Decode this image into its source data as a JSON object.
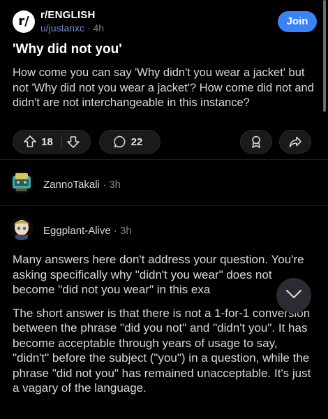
{
  "post": {
    "subreddit": "r/ENGLISH",
    "subreddit_icon": "r/",
    "author": "u/justanxc",
    "separator": "·",
    "age": "4h",
    "join_label": "Join",
    "title": "'Why did not you'",
    "body": "How come you can say 'Why didn't you wear a jacket' but not 'Why did not you wear a jacket'? How come did not and didn't are not interchangeable in this instance?",
    "upvotes": "18",
    "comments_count": "22"
  },
  "comments": [
    {
      "author": "ZannoTakali",
      "separator": "·",
      "age": "3h"
    },
    {
      "author": "Eggplant-Alive",
      "separator": "·",
      "age": "3h",
      "paragraphs": [
        "Many answers here don't address your question. You're asking specifically why \"didn't you wear\" does not become \"did not you wear\" in this exa",
        "The short answer is that there is not a 1-for-1 conversion between the phrase \"did you not\" and \"didn't you\".  It has become acceptable through years of usage to say, \"didn't\" before the subject (\"you\") in a question, while the phrase \"did not you\" has remained unacceptable.  It's just a vagary of the language."
      ]
    }
  ],
  "icons": [
    "upvote-icon",
    "downvote-icon",
    "comment-icon",
    "award-icon",
    "share-icon",
    "chevron-down-icon"
  ],
  "colors": {
    "background": "#000000",
    "join": "#3b82f6",
    "author_link": "#6c8ec7"
  }
}
